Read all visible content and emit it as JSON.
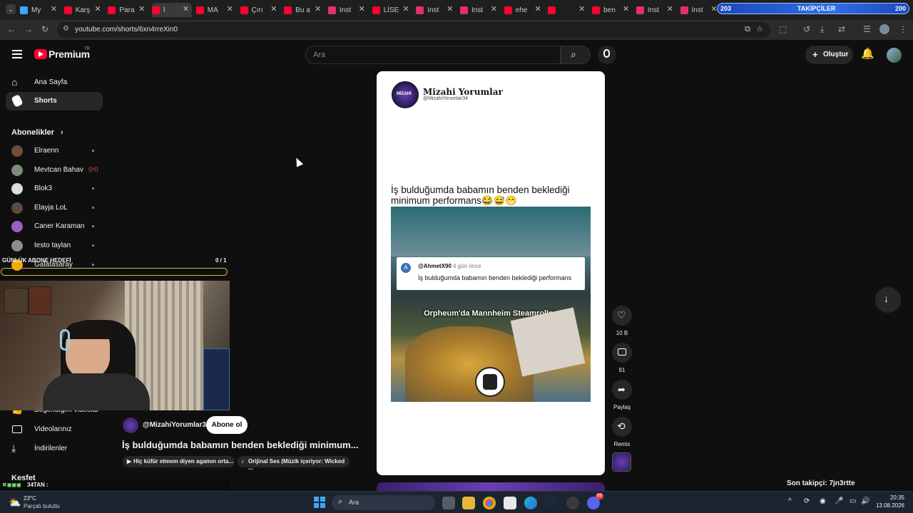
{
  "browser": {
    "tabs": [
      {
        "label": "My",
        "color": "#3ea6ff"
      },
      {
        "label": "Karş",
        "color": "#ff0033"
      },
      {
        "label": "Para",
        "color": "#ff0033"
      },
      {
        "label": "l",
        "color": "#ff0033"
      },
      {
        "label": "MA",
        "color": "#ff0033"
      },
      {
        "label": "Çırı",
        "color": "#ff0033"
      },
      {
        "label": "Bu a",
        "color": "#ff0033"
      },
      {
        "label": "Inst",
        "color": "#e1306c"
      },
      {
        "label": "LİSE",
        "color": "#ff0033"
      },
      {
        "label": "Inst",
        "color": "#e1306c"
      },
      {
        "label": "Inst",
        "color": "#e1306c"
      },
      {
        "label": "ehe",
        "color": "#ff0033"
      },
      {
        "label": "",
        "color": "#ff0033"
      },
      {
        "label": "ben",
        "color": "#ff0033"
      },
      {
        "label": "Inst",
        "color": "#e1306c"
      },
      {
        "label": "Inst",
        "color": "#e1306c"
      }
    ],
    "url": "youtube.com/shorts/6xn4rreXin0"
  },
  "overlay": {
    "followers_label": "TAKİPÇİLER",
    "followers_current": "203",
    "followers_goal": "200",
    "daily_goal_label": "GÜNLÜK ABONE HEDEFİ",
    "daily_goal_value": "0 / 1",
    "ticker": "34TAN :",
    "last_follower": "Son takipçi: 7jn3rtte"
  },
  "header": {
    "logo_text": "Premium",
    "logo_region": "TR",
    "search_placeholder": "Ara",
    "create_label": "Oluştur"
  },
  "sidebar": {
    "items": [
      {
        "label": "Ana Sayfa"
      },
      {
        "label": "Shorts"
      }
    ],
    "subscriptions_title": "Abonelikler",
    "subscriptions": [
      {
        "label": "Elraenn",
        "color": "#6b4f3b",
        "live": false
      },
      {
        "label": "Mevtcan Bahav",
        "color": "#7d8a7a",
        "live": true
      },
      {
        "label": "Blok3",
        "color": "#dddddd",
        "live": false
      },
      {
        "label": "Elayja LoL",
        "color": "#5a4a40",
        "live": false
      },
      {
        "label": "Caner Karaman",
        "color": "#9a62c0",
        "live": false
      },
      {
        "label": "testo taylan",
        "color": "#8c8c8c",
        "live": false
      },
      {
        "label": "Galatasaray",
        "color": "#f2a900",
        "live": false
      }
    ],
    "lower_items": [
      {
        "label": "Beğendiğim videolar"
      },
      {
        "label": "Videolarınız"
      },
      {
        "label": "İndirilenler"
      }
    ],
    "explore_title": "Keşfet"
  },
  "short": {
    "page_name": "Mizahi Yorumlar",
    "page_handle": "@MizahiYorumlar34",
    "post_caption": "İş bulduğumda babamın benden beklediği minimum performans😂😅😁",
    "comment_author": "@AhmetX90",
    "comment_time": "4 gün önce",
    "comment_text": "İş bulduğumda babamın benden beklediği performans",
    "video_caption": "Orpheum'da Mannheim Steamroller.",
    "channel_handle": "@MizahiYorumlar34",
    "subscribe_label": "Abone ol",
    "title": "İş bulduğumda babamın benden beklediği minimum...",
    "chips": [
      "Hiç küfür etmem diyen agamın orta...",
      "Orijinal Ses (Müzik içeriyor: Wicked ..."
    ]
  },
  "actions": {
    "likes": "10 B",
    "comments": "91",
    "share_label": "Paylaş",
    "remix_label": "Remix"
  },
  "taskbar": {
    "weather_temp": "23°C",
    "weather_desc": "Parçalı bulutlu",
    "search_placeholder": "Ara",
    "time": "20:35",
    "date": "13.08.2026",
    "discord_badge": "99"
  }
}
